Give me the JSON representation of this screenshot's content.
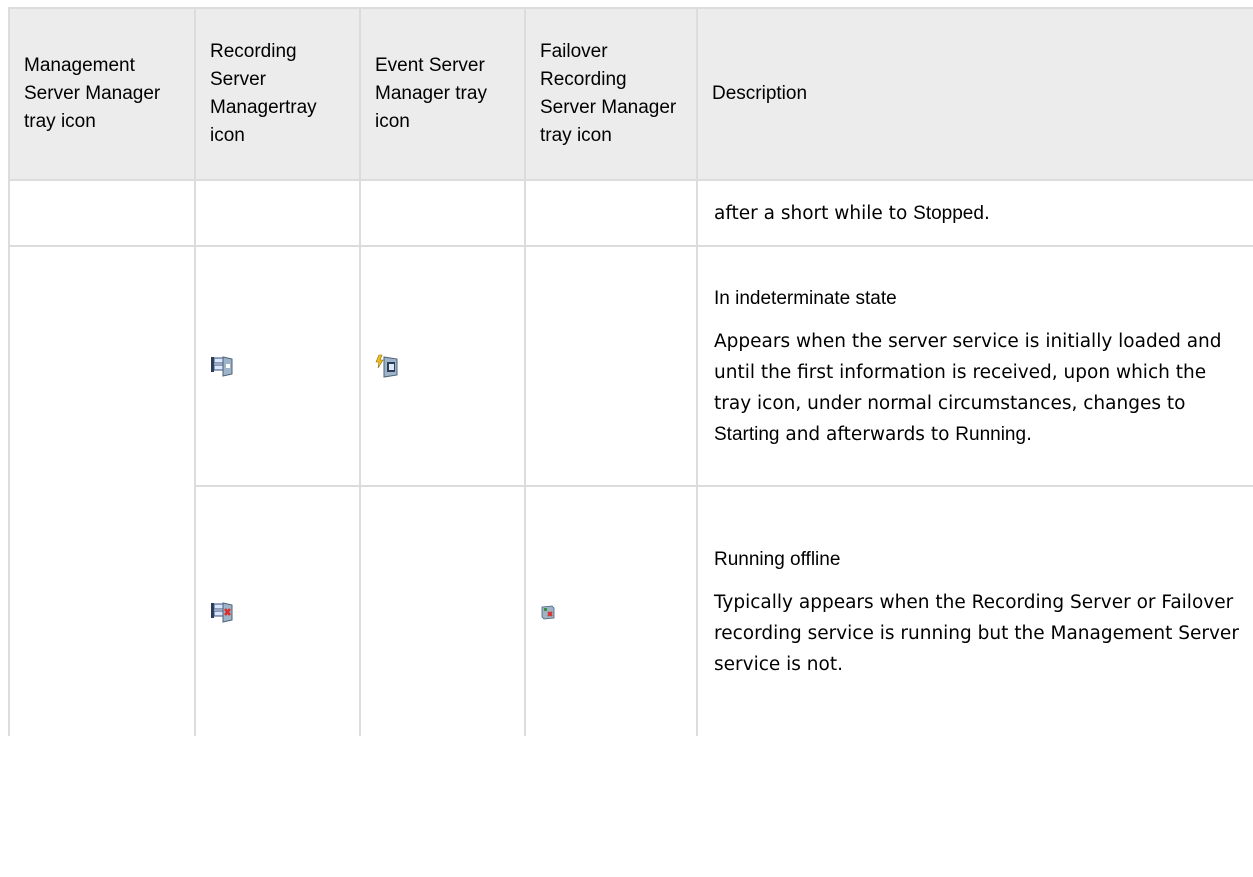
{
  "headers": {
    "management": "Management Server Manager tray icon",
    "recording": "Recording Server Managertray icon",
    "event": "Event Server Manager tray icon",
    "failover": "Failover Recording Server Manager tray icon",
    "description": "Description"
  },
  "rows": {
    "continued": {
      "text_prefix": "after a short while to ",
      "bold": "Stopped",
      "suffix": "."
    },
    "indeterminate": {
      "title": "In indeterminate state",
      "body_prefix": "Appears when the server service is initially loaded and until the first information is received, upon which the tray icon, under normal circumstances, changes to ",
      "bold1": "Starting",
      "middle": " and afterwards to ",
      "bold2": "Running",
      "suffix": ".",
      "recording_icon": "recording-server-indeterminate-icon",
      "event_icon": "event-server-indeterminate-icon"
    },
    "offline": {
      "title": "Running offline",
      "body": "Typically appears when the Recording Server or Failover recording service is running but the Management Server service is not.",
      "recording_icon": "recording-server-offline-icon",
      "failover_icon": "failover-server-offline-icon"
    }
  },
  "colors": {
    "header_bg": "#ececec",
    "border": "#dcdcdc",
    "error_red": "#d9302b"
  }
}
